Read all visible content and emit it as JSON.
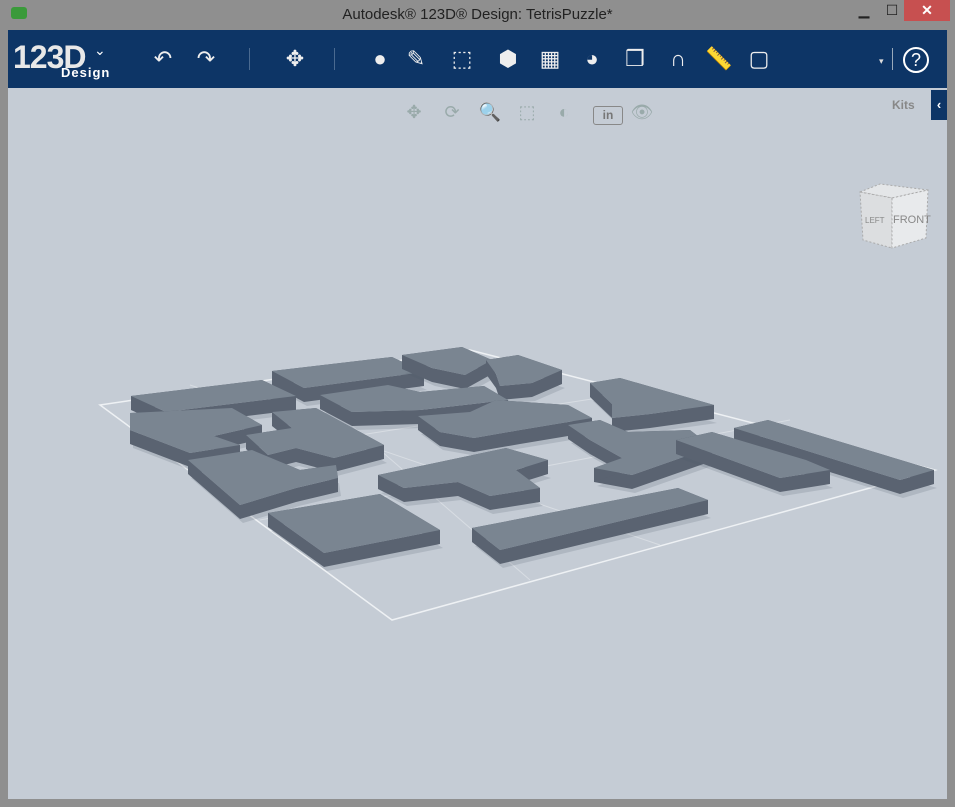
{
  "window": {
    "title": "Autodesk® 123D® Design: TetrisPuzzle*",
    "minimize": "▁",
    "maximize": "☐",
    "close": "✕"
  },
  "logo": {
    "main": "123D",
    "sub": "Design",
    "chevron": "⌄"
  },
  "toolbar": {
    "tools": [
      {
        "name": "undo-icon",
        "glyph": "↶"
      },
      {
        "name": "redo-icon",
        "glyph": "↷"
      },
      {
        "name": "transform-icon",
        "glyph": "✥"
      },
      {
        "name": "primitives-icon",
        "glyph": "●"
      },
      {
        "name": "sketch-icon",
        "glyph": "✎"
      },
      {
        "name": "construct-icon",
        "glyph": "⬚"
      },
      {
        "name": "modify-icon",
        "glyph": "⬢"
      },
      {
        "name": "pattern-icon",
        "glyph": "▦"
      },
      {
        "name": "group-icon",
        "glyph": "◕"
      },
      {
        "name": "combine-icon",
        "glyph": "❒"
      },
      {
        "name": "snap-icon",
        "glyph": "∩"
      },
      {
        "name": "measure-icon",
        "glyph": "📏"
      },
      {
        "name": "material-icon",
        "glyph": "▢"
      }
    ],
    "dropdown": "▾",
    "help": "?"
  },
  "navbar": {
    "pan": "✥",
    "orbit": "⟳",
    "zoom": "🔍",
    "fit": "⬚",
    "views": "◐",
    "units": "in",
    "visibility": "👁"
  },
  "kits": {
    "label": "Kits",
    "toggle": "‹"
  },
  "viewcube": {
    "left": "LEFT",
    "front": "FRONT"
  },
  "colors": {
    "toolbar": "#0d3566",
    "viewport": "#c5ccd5",
    "block_top": "#7a8591",
    "block_side": "#5a6371",
    "close": "#c75050"
  }
}
